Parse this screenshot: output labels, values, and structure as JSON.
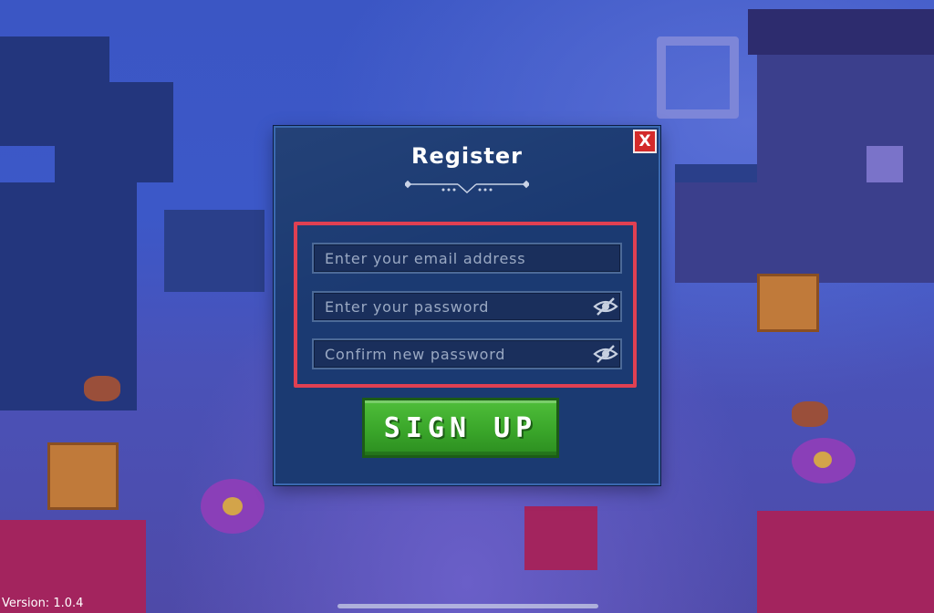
{
  "dialog": {
    "title": "Register",
    "close_label": "X"
  },
  "form": {
    "email_placeholder": "Enter your email address",
    "password_placeholder": "Enter your password",
    "confirm_placeholder": "Confirm new password",
    "submit_label": "SIGN UP"
  },
  "icons": {
    "close": "close-icon",
    "password_visibility": "eye-off-icon",
    "divider": "ornament-divider"
  },
  "footer": {
    "version": "Version: 1.0.4"
  },
  "colors": {
    "dialog_bg": "#1b3a72",
    "highlight_border": "#e04052",
    "signup_green": "#3aa62a",
    "close_red": "#d32a2a"
  }
}
